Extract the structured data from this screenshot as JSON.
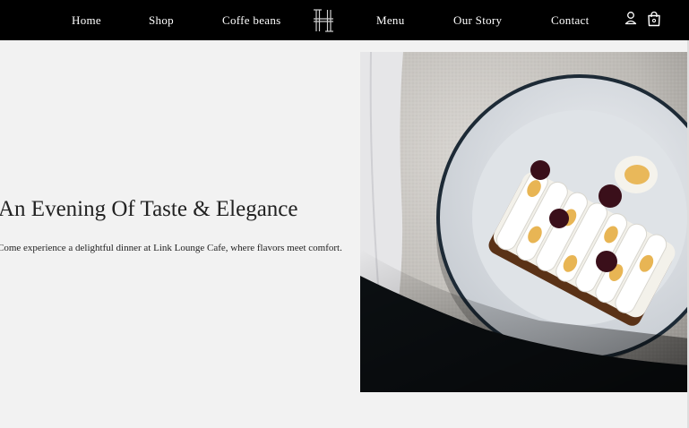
{
  "nav": {
    "home": "Home",
    "shop": "Shop",
    "coffee_beans": "Coffe beans",
    "menu": "Menu",
    "our_story": "Our Story",
    "contact": "Contact"
  },
  "hero": {
    "title": "An Evening Of Taste & Elegance",
    "text": "Come experience a delightful dinner at Link Lounge Cafe, where flavors meet comfort."
  },
  "colors": {
    "nav_background": "#000000",
    "page_background": "#f2f2f2",
    "text": "#222222"
  },
  "icons": [
    "logo-mark-icon",
    "user-icon",
    "shopping-bag-icon"
  ],
  "cart": {
    "count_text": ""
  }
}
